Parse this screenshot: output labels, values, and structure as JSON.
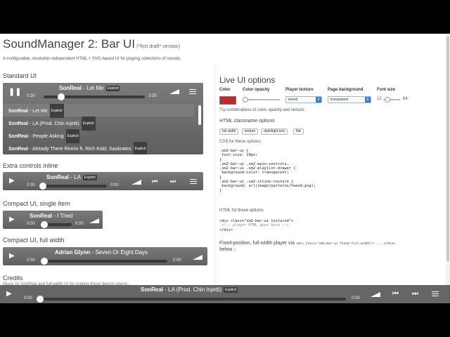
{
  "header": {
    "title": "SoundManager 2: Bar UI",
    "title_note": "(*first draft* version)",
    "tagline": "A configurable, resolution-independent HTML + SVG-based UI for playing collections of sounds."
  },
  "sections": {
    "standard": "Standard UI",
    "extra": "Extra controls inline",
    "compact_single": "Compact UI, single item",
    "compact_full": "Compact UI, full width",
    "credits": "Credits"
  },
  "credits_text": "Music by SonReal and full-width UI for making these demos sound...",
  "explicit": "Explicit",
  "standard_player": {
    "artist": "SonReal",
    "song": "Let Me",
    "time_current": "0:30",
    "time_total": "3:35",
    "progress": 0.14,
    "playlist": [
      {
        "artist": "SonReal",
        "song": "Let Me",
        "explicit": true,
        "selected": true
      },
      {
        "artist": "SonReal",
        "song": "LA (Prod. Chin Injetti)",
        "explicit": true,
        "selected": false
      },
      {
        "artist": "SonReal",
        "song": "People Asking",
        "explicit": true,
        "selected": false
      },
      {
        "artist": "SonReal",
        "song": "Already There Remix ft. Rich Kidd, Saukrates",
        "explicit": true,
        "selected": false
      }
    ]
  },
  "extra_player": {
    "artist": "SonReal",
    "song": "LA",
    "time_current": "0:00",
    "time_total": "0:00",
    "progress": 0
  },
  "compact_single_player": {
    "artist": "SonReal",
    "song": "I Tried",
    "time_current": "0:00",
    "time_total": "0:00",
    "progress": 0
  },
  "compact_full_player": {
    "artist": "Adrian Glynn",
    "song": "Seven Or Eight Days",
    "time_current": "0:00",
    "time_total": "0:00",
    "progress": 0
  },
  "footer_player": {
    "artist": "SonReal",
    "song": "LA (Prod. Chin Injetti)",
    "time_current": "0:00",
    "time_total": "0:00",
    "progress": 0
  },
  "live_options": {
    "title": "Live UI options",
    "labels": {
      "color": "Color",
      "opacity": "Color opacity",
      "texture": "Player texture",
      "background": "Page background",
      "font_size": "Font size"
    },
    "color_value": "#c1272d",
    "texture_value": "tweed",
    "background_value": "transparent",
    "font_min": "12",
    "font_max": "64",
    "hint": "Try combinations of color, opacity and texture.",
    "classnames_title": "HTML classname options",
    "classnames": [
      "full width",
      "texture",
      "dark/light text",
      "flat"
    ],
    "css_title": "CSS for these options:",
    "css_lines": [
      ".sm2-bar-ui {",
      " font-size: 19px;",
      "}",
      ".sm2-bar-ui .sm2-main-controls,",
      ".sm2-bar-ui .sm2-playlist-drawer {",
      " background-color: transparent;",
      "}",
      ".sm2-bar-ui .sm2-inline-texture {",
      " background: url(image/patterns/tweed.png);",
      "}"
    ],
    "html_title": "HTML for these options:",
    "html_lines": [
      "<div class=\"sm2-bar-ui textured\">",
      " <!-- player HTML goes here -->",
      "</div>"
    ],
    "fixed_text": "Fixed-position, full-width player via",
    "fixed_code": "<div class=\"sm2-bar-ui fixed full-width\"> ... </div>",
    "below": "below ↓"
  }
}
